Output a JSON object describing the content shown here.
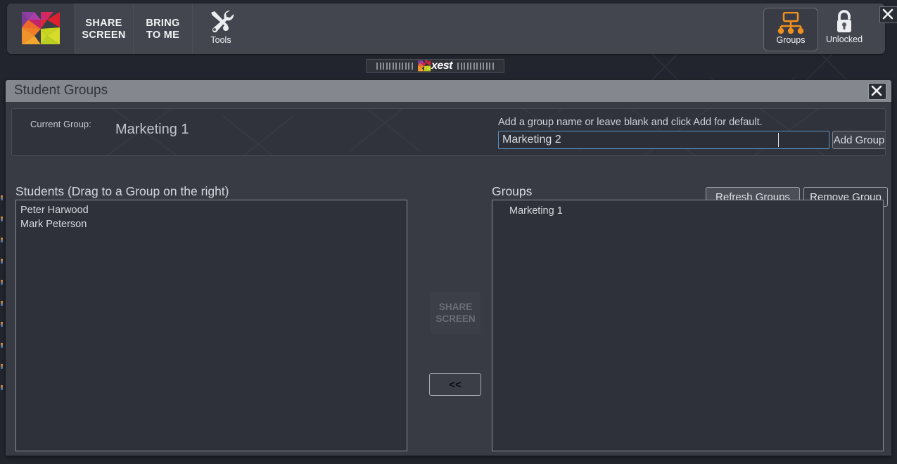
{
  "toolbar": {
    "logo_icon": "xest-x-logo-icon",
    "buttons": [
      {
        "name": "share-screen",
        "line1": "SHARE",
        "line2": "SCREEN"
      },
      {
        "name": "bring-to-me",
        "line1": "BRING",
        "line2": "TO ME"
      }
    ],
    "tools": {
      "label": "Tools",
      "icon": "tools-wrench-screwdriver-icon"
    },
    "groups": {
      "label": "Groups",
      "icon": "groups-hierarchy-icon"
    },
    "lock": {
      "label": "Unlocked",
      "icon": "open-padlock-icon"
    },
    "close_icon": "close-icon"
  },
  "badge": {
    "text": "xest",
    "x_icon": "xest-x-logo-icon"
  },
  "dialog": {
    "title": "Student Groups",
    "close_icon": "close-icon",
    "current_group_label": "Current Group:",
    "current_group_value": "Marketing 1",
    "add_group_hint": "Add a group name or leave blank and click Add for default.",
    "group_name_input_value": "Marketing 2",
    "group_name_input_placeholder": "",
    "add_group_label": "Add Group",
    "refresh_groups_label": "Refresh Groups",
    "remove_group_label": "Remove Group",
    "students_heading": "Students (Drag to a Group on the right)",
    "groups_heading": "Groups",
    "students": [
      {
        "name": "Peter Harwood"
      },
      {
        "name": "Mark Peterson"
      }
    ],
    "groups": [
      {
        "name": "Marketing 1"
      }
    ],
    "share_screen_mid": {
      "line1": "SHARE",
      "line2": "SCREEN"
    },
    "move_left_label": "<<"
  },
  "colors": {
    "toolbar_bg": "#44464f",
    "dialog_bg": "#383b44",
    "titlebar_bg": "#85878e",
    "list_bg": "#2e3139",
    "accent_orange": "#f0901e",
    "input_border": "#5a8fbf",
    "text_primary": "#d8dbe0"
  }
}
